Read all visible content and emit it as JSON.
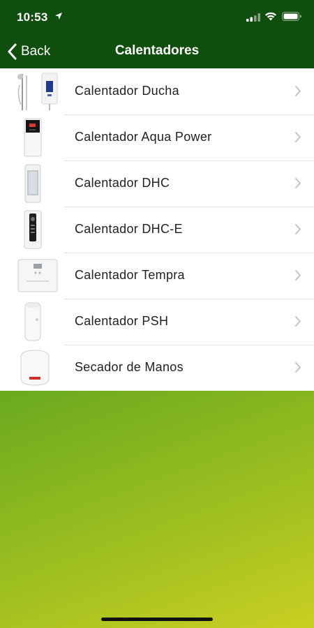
{
  "status_bar": {
    "time": "10:53",
    "location_icon": "location-arrow-icon",
    "signal_icon": "cellular-signal-icon",
    "wifi_icon": "wifi-icon",
    "battery_icon": "battery-icon"
  },
  "nav": {
    "back_label": "Back",
    "title": "Calentadores"
  },
  "items": [
    {
      "label": "Calentador Ducha",
      "thumbnail": "shower-heater-product-image"
    },
    {
      "label": "Calentador Aqua Power",
      "thumbnail": "aqua-power-heater-product-image"
    },
    {
      "label": "Calentador DHC",
      "thumbnail": "dhc-heater-product-image"
    },
    {
      "label": "Calentador DHC-E",
      "thumbnail": "dhc-e-heater-product-image"
    },
    {
      "label": "Calentador Tempra",
      "thumbnail": "tempra-heater-product-image"
    },
    {
      "label": "Calentador PSH",
      "thumbnail": "psh-heater-product-image"
    },
    {
      "label": "Secador de Manos",
      "thumbnail": "hand-dryer-product-image"
    }
  ],
  "colors": {
    "header_bg": "#0f4f0d",
    "gradient_start": "#217e1c",
    "gradient_end": "#c9cf22",
    "list_bg": "#ffffff",
    "chevron": "#c4c4c7"
  }
}
